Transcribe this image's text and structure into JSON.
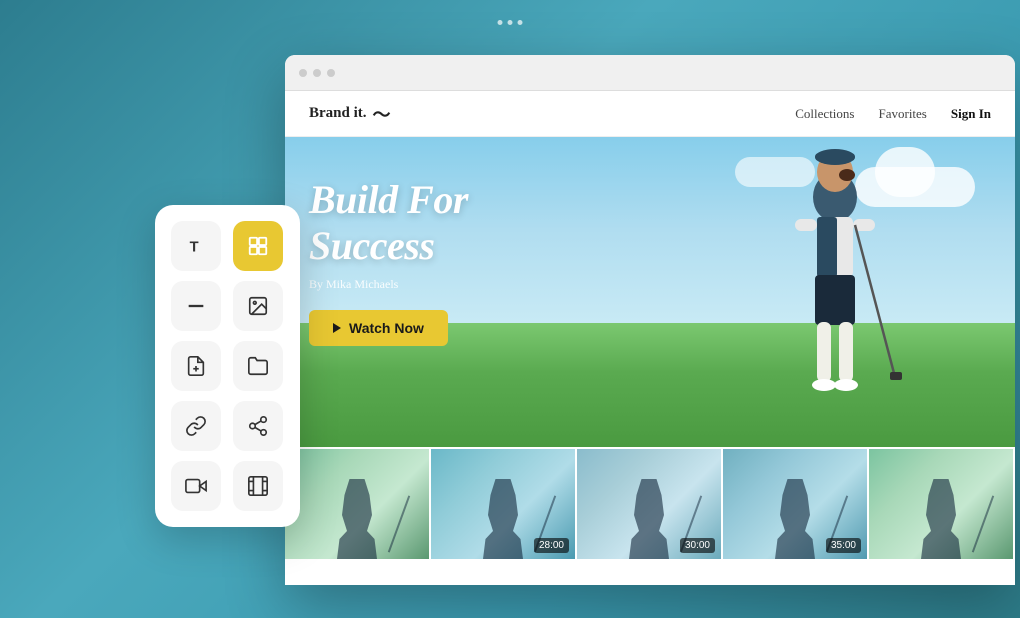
{
  "background": {
    "color": "#3a8fa0"
  },
  "window_dots": [
    "●",
    "●",
    "●"
  ],
  "browser": {
    "visible": true
  },
  "nav": {
    "brand": "Brand it.",
    "brand_squiggle": "〜",
    "links": [
      "Collections",
      "Favorites"
    ],
    "signin": "Sign In"
  },
  "hero": {
    "title_line1": "Build For",
    "title_line2": "Success",
    "author": "By Mika Michaels",
    "watch_now": "Watch Now"
  },
  "thumbnails": [
    {
      "duration": ""
    },
    {
      "duration": "28:00"
    },
    {
      "duration": "30:00"
    },
    {
      "duration": "35:00"
    },
    {
      "duration": ""
    }
  ],
  "toolbar": {
    "tools": [
      {
        "id": "text",
        "icon": "T",
        "active": false,
        "label": "text-tool"
      },
      {
        "id": "crop",
        "icon": "⊞",
        "active": true,
        "label": "crop-tool"
      },
      {
        "id": "minus",
        "icon": "—",
        "active": false,
        "label": "minus-tool"
      },
      {
        "id": "image",
        "icon": "🖼",
        "active": false,
        "label": "image-tool"
      },
      {
        "id": "file",
        "icon": "📄",
        "active": false,
        "label": "file-tool"
      },
      {
        "id": "folder",
        "icon": "📁",
        "active": false,
        "label": "folder-tool"
      },
      {
        "id": "link",
        "icon": "🔗",
        "active": false,
        "label": "link-tool"
      },
      {
        "id": "share",
        "icon": "⇢",
        "active": false,
        "label": "share-tool"
      },
      {
        "id": "video",
        "icon": "📹",
        "active": false,
        "label": "video-tool"
      },
      {
        "id": "grid",
        "icon": "⊞",
        "active": false,
        "label": "grid-tool"
      }
    ]
  }
}
